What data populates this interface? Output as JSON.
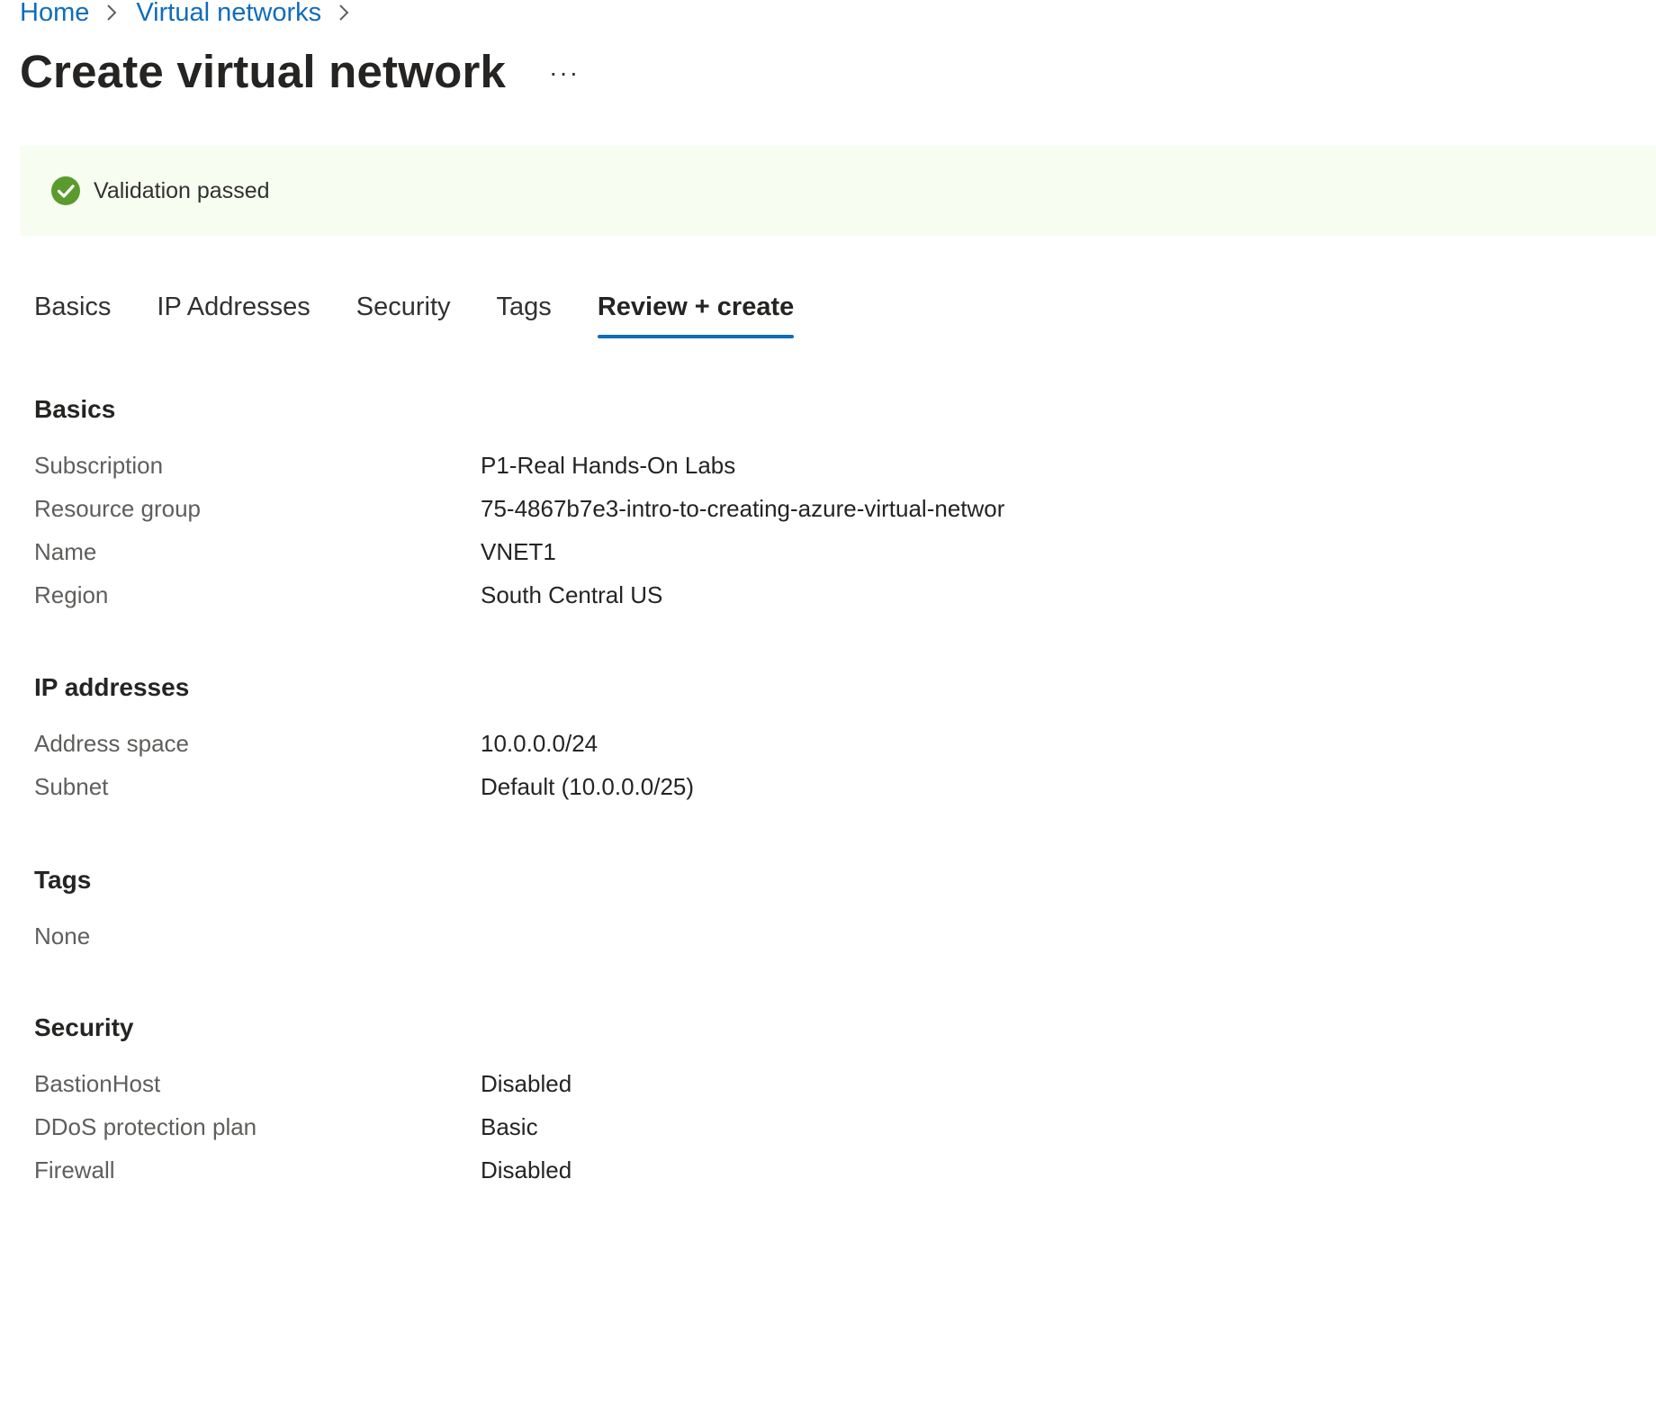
{
  "breadcrumb": {
    "items": [
      {
        "label": "Home"
      },
      {
        "label": "Virtual networks"
      }
    ]
  },
  "header": {
    "title": "Create virtual network",
    "more_label": "···"
  },
  "banner": {
    "status": "success",
    "icon": "check-circle-icon",
    "text": "Validation passed",
    "color": "#5b9a2d"
  },
  "tabs": [
    {
      "label": "Basics",
      "active": false
    },
    {
      "label": "IP Addresses",
      "active": false
    },
    {
      "label": "Security",
      "active": false
    },
    {
      "label": "Tags",
      "active": false
    },
    {
      "label": "Review + create",
      "active": true
    }
  ],
  "sections": {
    "basics": {
      "title": "Basics",
      "rows": [
        {
          "label": "Subscription",
          "value": "P1-Real Hands-On Labs"
        },
        {
          "label": "Resource group",
          "value": "75-4867b7e3-intro-to-creating-azure-virtual-networ"
        },
        {
          "label": "Name",
          "value": "VNET1"
        },
        {
          "label": "Region",
          "value": "South Central US"
        }
      ]
    },
    "ip_addresses": {
      "title": "IP addresses",
      "rows": [
        {
          "label": "Address space",
          "value": "10.0.0.0/24"
        },
        {
          "label": "Subnet",
          "value": "Default (10.0.0.0/25)"
        }
      ]
    },
    "tags": {
      "title": "Tags",
      "empty_text": "None"
    },
    "security": {
      "title": "Security",
      "rows": [
        {
          "label": "BastionHost",
          "value": "Disabled"
        },
        {
          "label": "DDoS protection plan",
          "value": "Basic"
        },
        {
          "label": "Firewall",
          "value": "Disabled"
        }
      ]
    }
  },
  "colors": {
    "accent": "#0f6cbd",
    "success_bg": "#f7fdf0"
  }
}
